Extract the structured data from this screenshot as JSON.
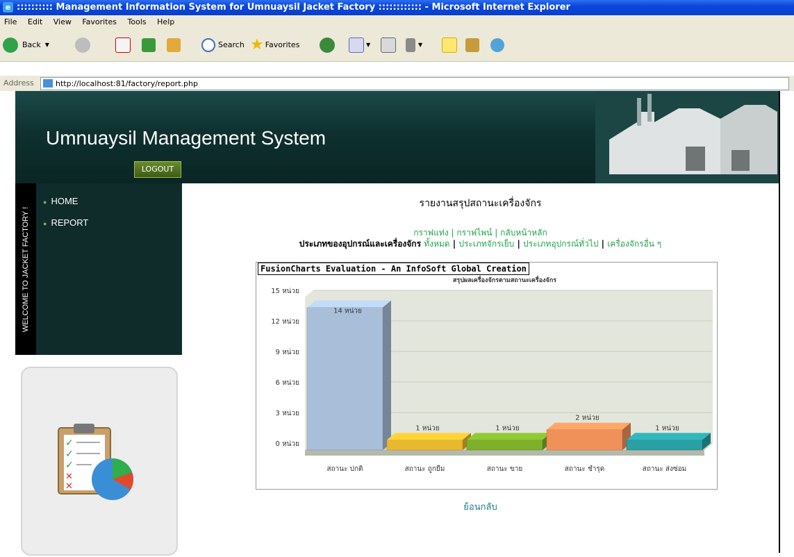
{
  "window": {
    "title": ":::::::::: Management Information System for Umnuaysil Jacket Factory :::::::::::: - Microsoft Internet Explorer"
  },
  "menu": [
    "File",
    "Edit",
    "View",
    "Favorites",
    "Tools",
    "Help"
  ],
  "toolbar": {
    "back": "Back",
    "search": "Search",
    "favorites": "Favorites"
  },
  "address": {
    "label": "Address",
    "url": "http://localhost:81/factory/report.php"
  },
  "site": {
    "brand": "Umnuaysil Management System",
    "logout": "LOGOUT",
    "welcome": "WELCOME TO JACKET FACTORY !",
    "nav": [
      {
        "label": "HOME"
      },
      {
        "label": "REPORT"
      }
    ],
    "page_title": "รายงานสรุปสถานะเครื่องจักร",
    "links1": [
      "กราฟแท่ง",
      "กราฟไพน์",
      "กลับหน้าหลัก"
    ],
    "links2_label": "ประเภทของอุปกรณ์และเครื่องจักร",
    "links2": [
      "ทั้งหมด",
      "ประเภทจักรเย็บ",
      "ประเภทอุปกรณ์ทั่วไป",
      "เครื่องจักรอื่น ๆ"
    ],
    "back": "ย้อนกลับ",
    "fusion_label": "FusionCharts Evaluation - An InfoSoft Global Creation"
  },
  "chart_data": {
    "type": "bar",
    "title": "สรุปผลเครื่องจักรตามสถานะเครื่องจักร",
    "categories": [
      "สถานะ ปกติ",
      "สถานะ ถูกยืม",
      "สถานะ ขาย",
      "สถานะ ชำรุด",
      "สถานะ ส่งซ่อม"
    ],
    "values": [
      14,
      1,
      1,
      2,
      1
    ],
    "value_labels": [
      "14 หน่วย",
      "1 หน่วย",
      "1 หน่วย",
      "2 หน่วย",
      "1 หน่วย"
    ],
    "yticks": [
      "0 หน่วย",
      "3 หน่วย",
      "6 หน่วย",
      "9 หน่วย",
      "12 หน่วย",
      "15 หน่วย"
    ],
    "ylim": [
      0,
      15
    ],
    "colors": [
      "#a9bfd9",
      "#e8b830",
      "#7fb02c",
      "#f0915a",
      "#2aa0a5"
    ]
  }
}
